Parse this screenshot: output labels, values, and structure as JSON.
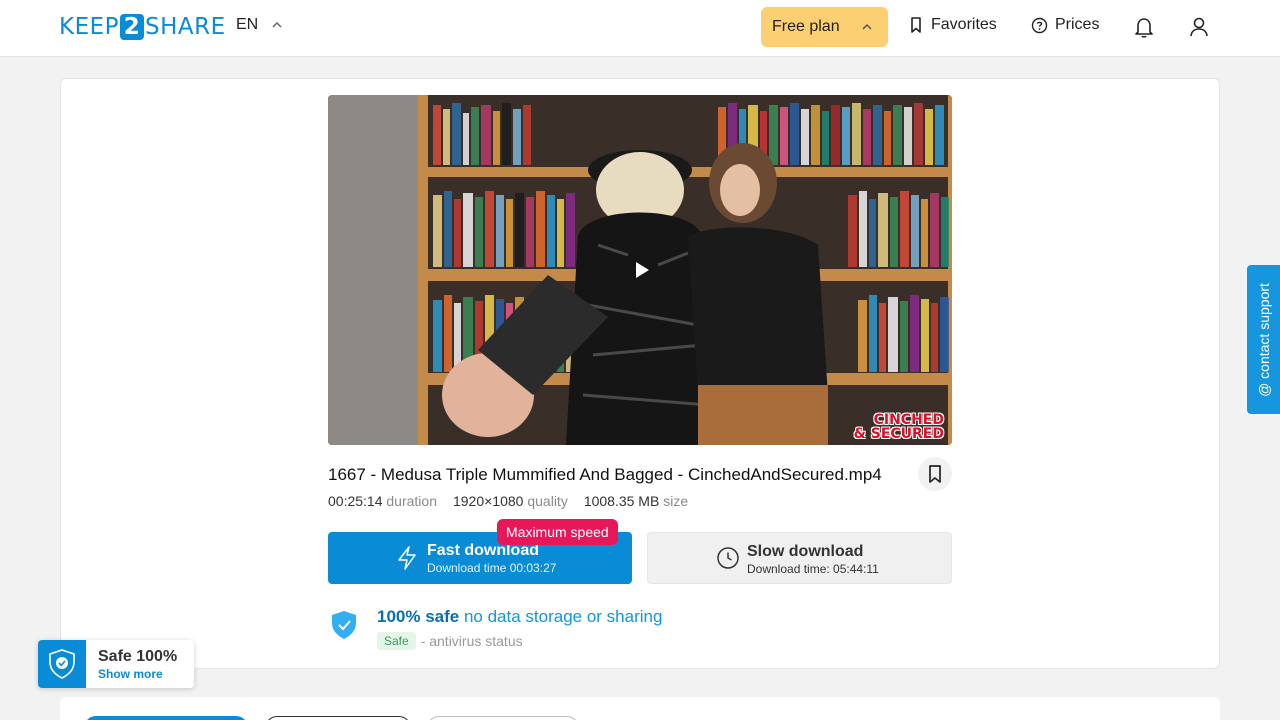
{
  "header": {
    "logo": {
      "left": "KEEP",
      "mid": "2",
      "right": "SHARE"
    },
    "language": "EN",
    "plan_label": "Free plan",
    "favorites_label": "Favorites",
    "prices_label": "Prices",
    "icons": [
      "chevron-up-icon",
      "bookmark-icon",
      "help-circle-icon",
      "bell-icon",
      "user-icon"
    ]
  },
  "video": {
    "watermark_line1": "CINCHED",
    "watermark_line2": "& SECURED"
  },
  "file": {
    "title": "1667 - Medusa Triple Mummified And Bagged - CinchedAndSecured.mp4",
    "duration_value": "00:25:14",
    "duration_label": "duration",
    "quality_value": "1920×1080",
    "quality_label": "quality",
    "size_value": "1008.35 MB",
    "size_label": "size"
  },
  "downloads": {
    "fast_label": "Fast download",
    "fast_time": "Download time 00:03:27",
    "badge": "Maximum speed",
    "slow_label": "Slow download",
    "slow_time": "Download time: 05:44:11"
  },
  "safety": {
    "strong": "100% safe",
    "light": "no data storage or sharing",
    "av_badge": "Safe",
    "av_label": "- antivirus status"
  },
  "support": {
    "label": "@ contact support"
  },
  "safe_widget": {
    "title": "Safe 100%",
    "link": "Show more"
  },
  "colors": {
    "brand": "#0a8bd6",
    "plan": "#fccf73",
    "badge": "#e7185a"
  }
}
